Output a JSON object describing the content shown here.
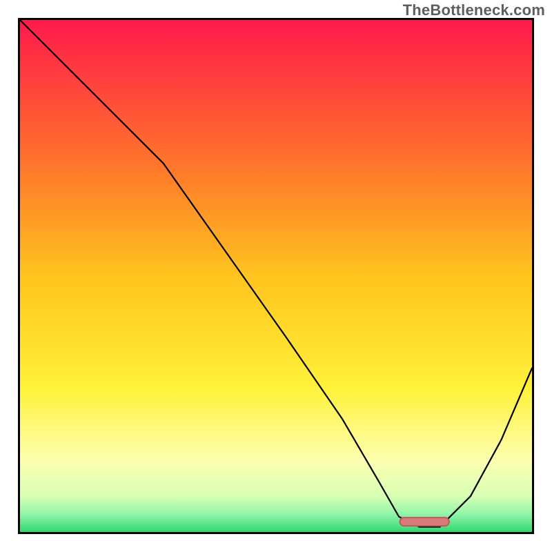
{
  "watermark": "TheBottleneck.com",
  "chart_data": {
    "type": "line",
    "title": "",
    "xlabel": "",
    "ylabel": "",
    "xlim": [
      0,
      100
    ],
    "ylim": [
      0,
      100
    ],
    "grid": false,
    "legend": false,
    "background_gradient_stops": [
      {
        "offset": 0,
        "color": "#ff1a4b"
      },
      {
        "offset": 0.25,
        "color": "#ff6a2e"
      },
      {
        "offset": 0.5,
        "color": "#ffc41e"
      },
      {
        "offset": 0.72,
        "color": "#fff23a"
      },
      {
        "offset": 0.86,
        "color": "#fdffb0"
      },
      {
        "offset": 0.93,
        "color": "#d8ffb4"
      },
      {
        "offset": 0.965,
        "color": "#92f5a9"
      },
      {
        "offset": 1.0,
        "color": "#2fd873"
      }
    ],
    "series": [
      {
        "name": "bottleneck-curve",
        "x": [
          0,
          10,
          20,
          28,
          40,
          52,
          63,
          70,
          74,
          78,
          82,
          88,
          94,
          100
        ],
        "values": [
          100,
          90,
          80,
          72,
          55,
          38,
          22,
          10,
          3,
          1,
          1,
          7,
          18,
          32
        ]
      }
    ],
    "marker": {
      "x_start": 75,
      "x_end": 83,
      "y": 2,
      "color": "#d77b7c"
    }
  }
}
